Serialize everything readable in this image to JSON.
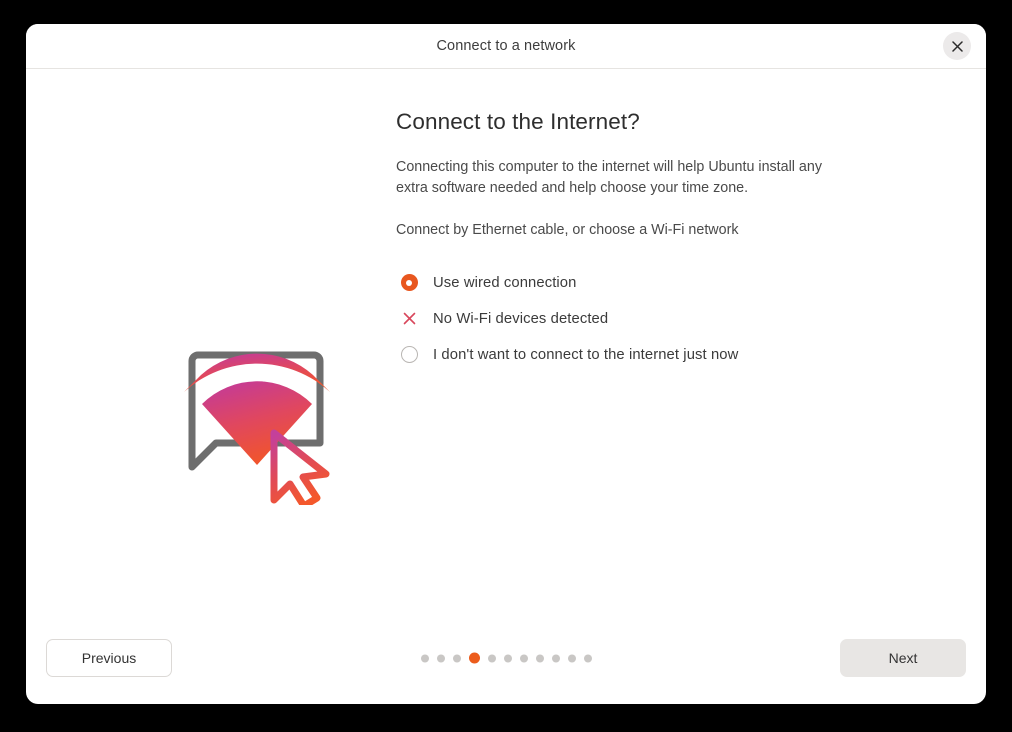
{
  "window": {
    "title": "Connect to a network",
    "close_icon": "close-icon"
  },
  "main": {
    "heading": "Connect to the Internet?",
    "paragraph_1": "Connecting this computer to the internet will help Ubuntu install any extra software needed and help choose your time zone.",
    "paragraph_2": "Connect by Ethernet cable, or choose a Wi-Fi network",
    "options": [
      {
        "label": "Use wired connection",
        "state": "selected",
        "marker": "radio-selected"
      },
      {
        "label": "No Wi-Fi devices detected",
        "state": "unavailable",
        "marker": "x-mark-icon"
      },
      {
        "label": "I don't want to connect to the internet just now",
        "state": "unselected",
        "marker": "radio-empty"
      }
    ],
    "illustration": "wifi-speech-bubble-cursor-illustration"
  },
  "footer": {
    "previous_label": "Previous",
    "next_label": "Next",
    "total_steps": 11,
    "active_step": 4
  },
  "colors": {
    "accent_orange": "#E8571F",
    "dot_active": "#EC5C1C",
    "dot_inactive": "#C9C7C5",
    "x_mark_red": "#D8475C",
    "gradient_start": "#C0399F",
    "gradient_end": "#F0542E",
    "bubble_outline": "#6E6E6E",
    "text_primary": "#3B3B3B",
    "background": "#000000"
  }
}
